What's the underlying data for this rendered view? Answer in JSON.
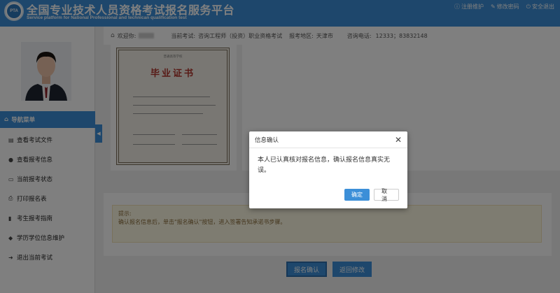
{
  "header": {
    "logo_text": "PTA",
    "title_cn": "全国专业技术人员资格考试报名服务平台",
    "title_en": "Service platform for National Professional and technican qualification test",
    "links": [
      {
        "icon": "info-icon",
        "label": "注册维护"
      },
      {
        "icon": "edit-icon",
        "label": "修改密码"
      },
      {
        "icon": "power-icon",
        "label": "安全退出"
      }
    ]
  },
  "infobar": {
    "welcome": "欢迎你:",
    "exam_label": "当前考试:",
    "exam_value": "咨询工程师（投资）职业资格考试",
    "region_label": "报考地区:",
    "region_value": "天津市",
    "phone_label": "咨询电话:",
    "phone_value": "12333；83832148"
  },
  "sidebar": {
    "nav_title": "导航菜单",
    "items": [
      {
        "icon": "file-icon",
        "label": "查看考试文件"
      },
      {
        "icon": "info-circle-icon",
        "label": "查看报考信息"
      },
      {
        "icon": "monitor-icon",
        "label": "当前报考状态"
      },
      {
        "icon": "print-icon",
        "label": "打印报名表"
      },
      {
        "icon": "book-icon",
        "label": "考生报考指南"
      },
      {
        "icon": "graduation-cap-icon",
        "label": "学历学位信息维护"
      },
      {
        "icon": "sign-out-icon",
        "label": "退出当前考试"
      }
    ]
  },
  "certificate": {
    "header_text": "普通高等学校",
    "title": "毕业证书"
  },
  "hint": {
    "title": "提示:",
    "text": "确认报名信息后，单击\"报名确认\"按钮，进入签署告知承诺书步骤。"
  },
  "buttons": {
    "submit": "报名确认",
    "back": "返回修改"
  },
  "modal": {
    "title": "信息确认",
    "body": "本人已认真核对报名信息，确认报名信息真实无误。",
    "ok": "确定",
    "cancel": "取消"
  },
  "colors": {
    "primary": "#3c8fd8",
    "hint_bg": "#fcf8e3",
    "cert_red": "#b0342c"
  }
}
